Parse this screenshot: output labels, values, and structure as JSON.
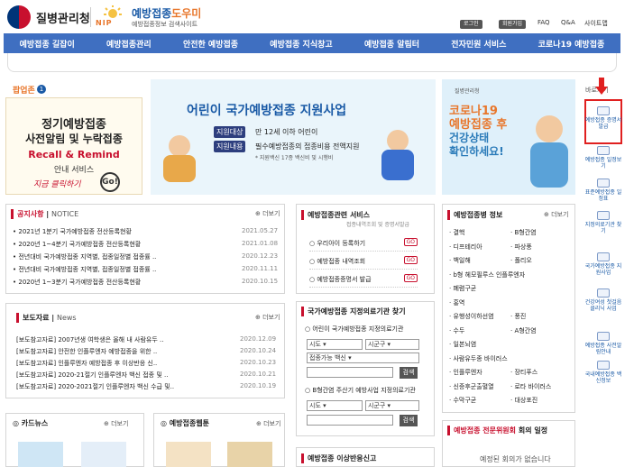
{
  "header": {
    "org_name": "질병관리청",
    "nip_label": "NIP",
    "brand_main": "예방접종",
    "brand_accent": "도우미",
    "brand_sub": "예방접종정보 검색사이트",
    "login_label": "로그인",
    "join_label": "회원가입",
    "faq_label": "FAQ",
    "qa_label": "Q&A",
    "sitemap_label": "사이트맵"
  },
  "nav": {
    "items": [
      "예방접종 길잡이",
      "예방접종관리",
      "안전한 예방접종",
      "예방접종 지식창고",
      "예방접종 알림터",
      "전자민원 서비스",
      "코로나19 예방접종"
    ]
  },
  "popup_zone": {
    "title": "팝업존",
    "badge": "1",
    "line1": "정기예방접종",
    "line2": "사전알림 및 누락접종",
    "line3": "Recall & Remind",
    "line4": "안내 서비스",
    "line5": "지금 클릭하기",
    "go": "Go!"
  },
  "hero": {
    "title": "어린이 국가예방접종 지원사업",
    "target_label": "지원대상",
    "target_value": "만 12세 이하 어린이",
    "content_label": "지원내용",
    "content_value": "필수예방접종의 접종비용 전액지원",
    "note": "* 지원백신 17종 백신비 및 시행비"
  },
  "covid_banner": {
    "agency": "질병관리청",
    "line1": "코로나19",
    "line2": "예방접종 후",
    "line3": "건강상태",
    "line4": "확인하세요!"
  },
  "quick_menu": {
    "header": "바로가기",
    "items": [
      "예방접종 증명서 발급",
      "예방접종 일정보기",
      "표준예방접종 일정표",
      "지정의료기관 찾기",
      "국가예방접종 지원사업",
      "건강여성 첫걸음 클리닉 사업",
      "예방접종 사전알림안내",
      "국내예방접종 백신정보"
    ]
  },
  "notice": {
    "tab1": "공지사항",
    "tab2": "NOTICE",
    "more": "더보기",
    "items": [
      {
        "title": "2021년 1분기 국가예방접종 전산등록현황",
        "date": "2021.05.27"
      },
      {
        "title": "2020년 1~4분기 국가예방접종 전산등록현황",
        "date": "2021.01.08"
      },
      {
        "title": "전년대비 국가예방접종 지역별, 접종일정별 접종률 ..",
        "date": "2020.12.23"
      },
      {
        "title": "전년대비 국가예방접종 지역별, 접종일정별 접종률 ..",
        "date": "2020.11.11"
      },
      {
        "title": "2020년 1~3분기 국가예방접종 전산등록현황",
        "date": "2020.10.15"
      }
    ]
  },
  "press": {
    "tab1": "보도자료",
    "tab2": "News",
    "more": "더보기",
    "items": [
      {
        "title": "[보도참고자료] 2007년생 여학생은 올해 내 사람유두 ..",
        "date": "2020.12.09"
      },
      {
        "title": "[보도참고자료] 안전한 인플루엔자 예방접종을 위한 ..",
        "date": "2020.10.24"
      },
      {
        "title": "[보도참고자료] 인플루엔자 예방접종 후 이상반응 신..",
        "date": "2020.10.23"
      },
      {
        "title": "[보도참고자료] 2020-21절기 인플루엔자 백신 접종 및 ..",
        "date": "2020.10.21"
      },
      {
        "title": "[보도참고자료] 2020-2021절기 인플루엔자 백신 수급 및..",
        "date": "2020.10.19"
      }
    ]
  },
  "cards": {
    "cardnews": "카드뉴스",
    "cardnews_more": "더보기",
    "webtoon": "예방접종웹툰",
    "webtoon_more": "더보기"
  },
  "services": {
    "title": "예방접종관련 서비스",
    "subtitle": "접종내역조회 및 증명서발급",
    "go_label": "GO",
    "items": [
      "우리아이 등록하기",
      "예방접종 내역조회",
      "예방접종증명서 발급"
    ]
  },
  "clinic_search": {
    "title": "국가예방접종 지정의료기관 찾기",
    "sub1": "어린이 국가예방접종 지정의료기관",
    "sido": "시도",
    "sigungu": "시군구",
    "vaccine": "접종가능 백신",
    "search_btn": "검색",
    "sub2": "B형간염 주산기 예방사업 지정의료기관"
  },
  "adverse": {
    "title": "예방접종 이상반응신고"
  },
  "diseases": {
    "title": "예방접종병 정보",
    "more": "더보기",
    "col1": [
      "결핵",
      "디프테리아",
      "백일해",
      "b형 헤모필루스 인플루엔자",
      "폐렴구균",
      "홍역",
      "유행성이하선염",
      "수두",
      "일본뇌염",
      "사람유두종 바이러스",
      "인플루엔자",
      "신증후군출혈열",
      "수막구균"
    ],
    "col2": [
      "B형간염",
      "파상풍",
      "폴리오",
      "",
      "",
      "",
      "풍진",
      "A형간염",
      "",
      "",
      "장티푸스",
      "로타 바이러스",
      "대상포진"
    ]
  },
  "committee": {
    "title": "예방접종 전문위원회",
    "title2": "회의 일정",
    "empty": "예정된 회의가 없습니다"
  },
  "colors": {
    "nav_bg": "#3f6fc1",
    "accent_orange": "#e8762b",
    "accent_red": "#c8102e",
    "brand_blue": "#1a5aa6"
  }
}
